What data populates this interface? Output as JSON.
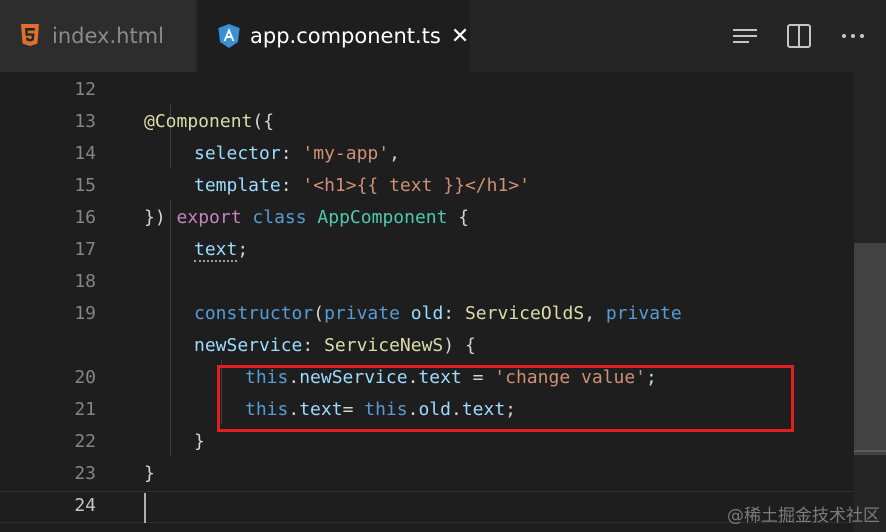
{
  "tabs": [
    {
      "label": "index.html",
      "icon": "html5-icon",
      "active": false
    },
    {
      "label": "app.component.ts",
      "icon": "angular-icon",
      "active": true,
      "close": "✕"
    }
  ],
  "editor": {
    "line_numbers": [
      "12",
      "13",
      "14",
      "15",
      "16",
      "17",
      "18",
      "19",
      "",
      "20",
      "21",
      "22",
      "23",
      "24"
    ],
    "lines": [
      {
        "t1": "@Component",
        "t2": "({"
      },
      {
        "t1": "selector",
        "t2": ": ",
        "t3": "'my-app'",
        "t4": ","
      },
      {
        "t1": "template",
        "t2": ": ",
        "t3": "'<h1>{{ text }}</h1>'"
      },
      {
        "t1": "}) ",
        "t2": "export",
        "t3": " ",
        "t4": "class",
        "t5": " ",
        "t6": "AppComponent",
        "t7": " {"
      },
      {
        "t1": "text",
        "t2": ";"
      },
      {
        "t1": "constructor",
        "t2": "(",
        "t3": "private",
        "t4": " ",
        "t5": "old",
        "t6": ": ",
        "t7": "ServiceOldS",
        "t8": ", ",
        "t9": "private"
      },
      {
        "t1": "newService",
        "t2": ": ",
        "t3": "ServiceNewS",
        "t4": ") {"
      },
      {
        "t1": "this",
        "t2": ".",
        "t3": "newService",
        "t4": ".",
        "t5": "text",
        "t6": " = ",
        "t7": "'change value'",
        "t8": ";"
      },
      {
        "t1": "this",
        "t2": ".",
        "t3": "text",
        "t4": "= ",
        "t5": "this",
        "t6": ".",
        "t7": "old",
        "t8": ".",
        "t9": "text",
        "t10": ";"
      },
      {
        "t1": "}"
      },
      {
        "t1": "}"
      }
    ]
  },
  "colors": {
    "highlight_box": "#e02020",
    "background": "#1e1e1e"
  },
  "watermark": "@稀土掘金技术社区"
}
